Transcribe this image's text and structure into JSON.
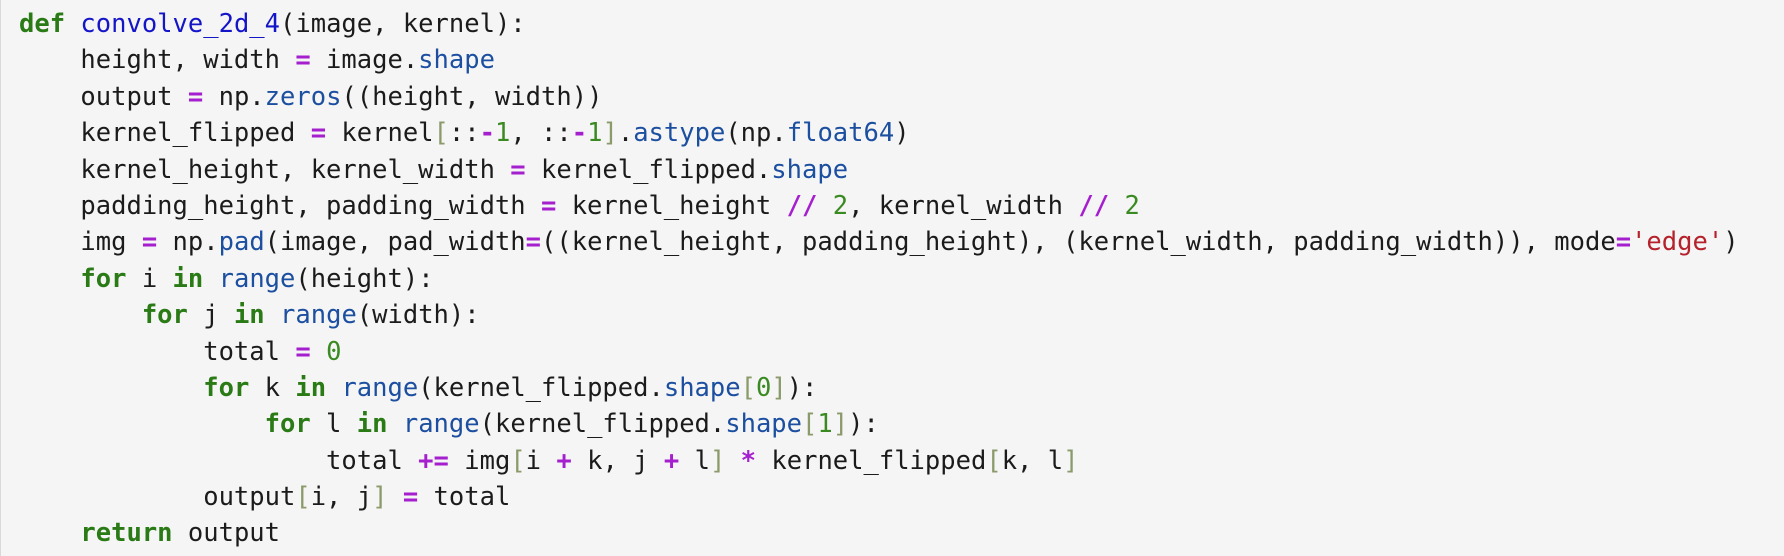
{
  "lines": [
    [
      [
        "kw",
        "def"
      ],
      [
        "tx",
        " "
      ],
      [
        "fn",
        "convolve_2d_4"
      ],
      [
        "tx",
        "(image, kernel):"
      ]
    ],
    [
      [
        "tx",
        "    height, width "
      ],
      [
        "op",
        "="
      ],
      [
        "tx",
        " image."
      ],
      [
        "at",
        "shape"
      ]
    ],
    [
      [
        "tx",
        "    output "
      ],
      [
        "op",
        "="
      ],
      [
        "tx",
        " np."
      ],
      [
        "at",
        "zeros"
      ],
      [
        "tx",
        "((height, width))"
      ]
    ],
    [
      [
        "tx",
        "    kernel_flipped "
      ],
      [
        "op",
        "="
      ],
      [
        "tx",
        " kernel"
      ],
      [
        "br",
        "["
      ],
      [
        "tx",
        "::"
      ],
      [
        "op",
        "-"
      ],
      [
        "num",
        "1"
      ],
      [
        "tx",
        ", ::"
      ],
      [
        "op",
        "-"
      ],
      [
        "num",
        "1"
      ],
      [
        "br",
        "]"
      ],
      [
        "tx",
        "."
      ],
      [
        "at",
        "astype"
      ],
      [
        "tx",
        "(np."
      ],
      [
        "at",
        "float64"
      ],
      [
        "tx",
        ")"
      ]
    ],
    [
      [
        "tx",
        "    kernel_height, kernel_width "
      ],
      [
        "op",
        "="
      ],
      [
        "tx",
        " kernel_flipped."
      ],
      [
        "at",
        "shape"
      ]
    ],
    [
      [
        "tx",
        "    padding_height, padding_width "
      ],
      [
        "op",
        "="
      ],
      [
        "tx",
        " kernel_height "
      ],
      [
        "op",
        "//"
      ],
      [
        "tx",
        " "
      ],
      [
        "num",
        "2"
      ],
      [
        "tx",
        ", kernel_width "
      ],
      [
        "op",
        "//"
      ],
      [
        "tx",
        " "
      ],
      [
        "num",
        "2"
      ]
    ],
    [
      [
        "tx",
        "    img "
      ],
      [
        "op",
        "="
      ],
      [
        "tx",
        " np."
      ],
      [
        "at",
        "pad"
      ],
      [
        "tx",
        "(image, pad_width"
      ],
      [
        "op",
        "="
      ],
      [
        "tx",
        "((kernel_height, padding_height), (kernel_width, padding_width)), mode"
      ],
      [
        "op",
        "="
      ],
      [
        "str",
        "'edge'"
      ],
      [
        "tx",
        ")"
      ]
    ],
    [
      [
        "tx",
        "    "
      ],
      [
        "kw",
        "for"
      ],
      [
        "tx",
        " i "
      ],
      [
        "kw",
        "in"
      ],
      [
        "tx",
        " "
      ],
      [
        "at",
        "range"
      ],
      [
        "tx",
        "(height):"
      ]
    ],
    [
      [
        "tx",
        "        "
      ],
      [
        "kw",
        "for"
      ],
      [
        "tx",
        " j "
      ],
      [
        "kw",
        "in"
      ],
      [
        "tx",
        " "
      ],
      [
        "at",
        "range"
      ],
      [
        "tx",
        "(width):"
      ]
    ],
    [
      [
        "tx",
        "            total "
      ],
      [
        "op",
        "="
      ],
      [
        "tx",
        " "
      ],
      [
        "num",
        "0"
      ]
    ],
    [
      [
        "tx",
        "            "
      ],
      [
        "kw",
        "for"
      ],
      [
        "tx",
        " k "
      ],
      [
        "kw",
        "in"
      ],
      [
        "tx",
        " "
      ],
      [
        "at",
        "range"
      ],
      [
        "tx",
        "(kernel_flipped."
      ],
      [
        "at",
        "shape"
      ],
      [
        "br",
        "["
      ],
      [
        "num",
        "0"
      ],
      [
        "br",
        "]"
      ],
      [
        "tx",
        "):"
      ]
    ],
    [
      [
        "tx",
        "                "
      ],
      [
        "kw",
        "for"
      ],
      [
        "tx",
        " l "
      ],
      [
        "kw",
        "in"
      ],
      [
        "tx",
        " "
      ],
      [
        "at",
        "range"
      ],
      [
        "tx",
        "(kernel_flipped."
      ],
      [
        "at",
        "shape"
      ],
      [
        "br",
        "["
      ],
      [
        "num",
        "1"
      ],
      [
        "br",
        "]"
      ],
      [
        "tx",
        "):"
      ]
    ],
    [
      [
        "tx",
        "                    total "
      ],
      [
        "op",
        "+="
      ],
      [
        "tx",
        " img"
      ],
      [
        "br",
        "["
      ],
      [
        "tx",
        "i "
      ],
      [
        "op",
        "+"
      ],
      [
        "tx",
        " k, j "
      ],
      [
        "op",
        "+"
      ],
      [
        "tx",
        " l"
      ],
      [
        "br",
        "]"
      ],
      [
        "tx",
        " "
      ],
      [
        "op",
        "*"
      ],
      [
        "tx",
        " kernel_flipped"
      ],
      [
        "br",
        "["
      ],
      [
        "tx",
        "k, l"
      ],
      [
        "br",
        "]"
      ]
    ],
    [
      [
        "tx",
        "            output"
      ],
      [
        "br",
        "["
      ],
      [
        "tx",
        "i, j"
      ],
      [
        "br",
        "]"
      ],
      [
        "tx",
        " "
      ],
      [
        "op",
        "="
      ],
      [
        "tx",
        " total"
      ]
    ],
    [
      [
        "tx",
        "    "
      ],
      [
        "kw",
        "return"
      ],
      [
        "tx",
        " output"
      ]
    ]
  ]
}
